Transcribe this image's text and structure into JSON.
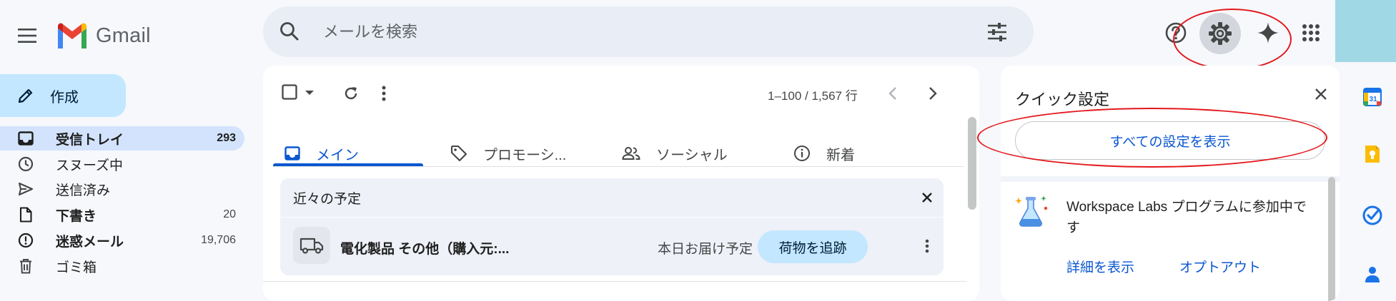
{
  "header": {
    "app_name": "Gmail",
    "search_placeholder": "メールを検索"
  },
  "sidebar": {
    "compose_label": "作成",
    "items": [
      {
        "label": "受信トレイ",
        "count": "293"
      },
      {
        "label": "スヌーズ中",
        "count": ""
      },
      {
        "label": "送信済み",
        "count": ""
      },
      {
        "label": "下書き",
        "count": "20"
      },
      {
        "label": "迷惑メール",
        "count": "19,706"
      },
      {
        "label": "ゴミ箱",
        "count": ""
      }
    ]
  },
  "main": {
    "pagination": "1–100 / 1,567 行",
    "tabs": [
      {
        "label": "メイン"
      },
      {
        "label": "プロモーシ..."
      },
      {
        "label": "ソーシャル"
      },
      {
        "label": "新着"
      }
    ],
    "upcoming": {
      "title": "近々の予定",
      "item_title": "電化製品 その他（購入元:...",
      "item_status": "本日お届け予定",
      "track_label": "荷物を追跡"
    }
  },
  "quick_settings": {
    "title": "クイック設定",
    "see_all_label": "すべての設定を表示",
    "labs_text": "Workspace Labs プログラムに参加中です",
    "details_label": "詳細を表示",
    "optout_label": "オプトアウト"
  },
  "colors": {
    "accent": "#0b57d0",
    "compose_bg": "#c2e7ff",
    "active_nav_bg": "#d3e3fd",
    "highlight_ellipse": "#e3161c",
    "background": "#f6f8fc"
  },
  "side_panel_apps": [
    "calendar-icon",
    "keep-icon",
    "tasks-icon",
    "contacts-icon"
  ]
}
